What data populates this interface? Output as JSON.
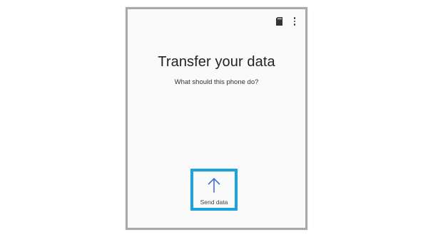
{
  "screen": {
    "title": "Transfer your data",
    "subtitle": "What should this phone do?"
  },
  "topbar": {
    "sd_card_icon": "sd-card-icon",
    "more_icon": "more-vertical-icon"
  },
  "send_option": {
    "label": "Send data",
    "icon": "arrow-up-icon",
    "icon_color": "#3f6fd8",
    "highlight_color": "#1aa3dd"
  }
}
